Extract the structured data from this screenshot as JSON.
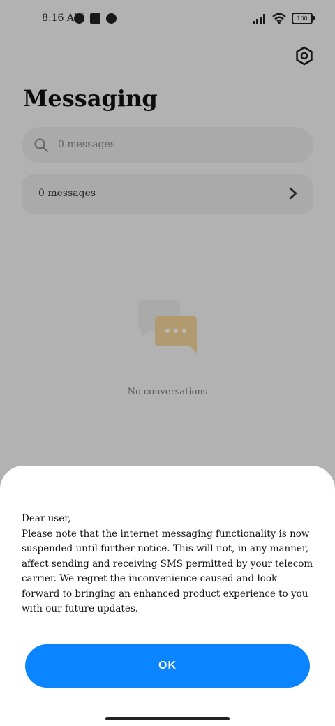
{
  "status_bar": {
    "time": "8:16 AM",
    "battery": "100"
  },
  "header": {
    "title": "Messaging"
  },
  "search": {
    "placeholder": "0 messages"
  },
  "messages_row": {
    "label": "0 messages"
  },
  "empty_state": {
    "text": "No conversations"
  },
  "dialog": {
    "body_lines": [
      "Dear user,",
      "Please note that the internet messaging functionality is now suspended until further notice. This will not, in any manner, affect sending and receiving SMS permitted by your telecom carrier. We regret the inconvenience caused and look forward to bringing an enhanced product experience to you with our future updates."
    ],
    "ok_label": "OK"
  },
  "colors": {
    "accent": "#0a84ff",
    "illustration": "#f3d39a"
  }
}
